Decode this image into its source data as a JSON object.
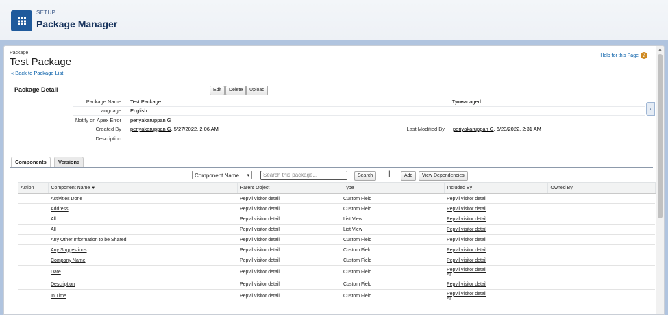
{
  "header": {
    "section": "SETUP",
    "title": "Package Manager",
    "app_icon": "app-launcher-grid-icon"
  },
  "page": {
    "breadcrumb": "Package",
    "title": "Test Package",
    "back_link": "« Back to Package List",
    "help_link": "Help for this Page",
    "help_icon": "help-question-icon"
  },
  "detail": {
    "heading": "Package Detail",
    "buttons": {
      "edit": "Edit",
      "delete": "Delete",
      "upload": "Upload"
    },
    "labels": {
      "package_name": "Package Name",
      "language": "Language",
      "notify": "Notify on Apex Error",
      "created_by": "Created By",
      "description": "Description",
      "type": "Type",
      "last_modified_by": "Last Modified By"
    },
    "values": {
      "package_name": "Test Package",
      "language": "English",
      "notify": "periyakaruppan G",
      "created_by_user": "periyakaruppan G",
      "created_by_date": ", 5/27/2022, 2:06 AM",
      "description": "",
      "type": "Unmanaged",
      "last_modified_user": "periyakaruppan G",
      "last_modified_date": ", 6/23/2022, 2:31 AM"
    }
  },
  "tabs": {
    "components": "Components",
    "versions": "Versions"
  },
  "toolbar": {
    "select_value": "Component Name",
    "search_placeholder": "Search this package...",
    "search_label": "Search",
    "add_label": "Add",
    "view_deps_label": "View Dependencies"
  },
  "table": {
    "columns": {
      "action": "Action",
      "component_name": "Component Name",
      "parent_object": "Parent Object",
      "type": "Type",
      "included_by": "Included By",
      "owned_by": "Owned By"
    },
    "sort_icon": "sort-descending-icon",
    "rows": [
      {
        "name": "Activities Done",
        "parent": "Pepvil visitor detail",
        "type": "Custom Field",
        "included": "Pepvil visitor detail",
        "included_sub": ""
      },
      {
        "name": "Address",
        "parent": "Pepvil visitor detail",
        "type": "Custom Field",
        "included": "Pepvil visitor detail",
        "included_sub": ""
      },
      {
        "name": "All",
        "parent": "Pepvil visitor detail",
        "type": "List View",
        "included": "Pepvil visitor detail",
        "included_sub": ""
      },
      {
        "name": "All",
        "parent": "Pepvil visitor detail",
        "type": "List View",
        "included": "Pepvil visitor detail",
        "included_sub": ""
      },
      {
        "name": "Any Other Information to be Shared",
        "parent": "Pepvil visitor detail",
        "type": "Custom Field",
        "included": "Pepvil visitor detail",
        "included_sub": ""
      },
      {
        "name": "Any Suggestions",
        "parent": "Pepvil visitor detail",
        "type": "Custom Field",
        "included": "Pepvil visitor detail",
        "included_sub": ""
      },
      {
        "name": "Company Name",
        "parent": "Pepvil visitor detail",
        "type": "Custom Field",
        "included": "Pepvil visitor detail",
        "included_sub": ""
      },
      {
        "name": "Date",
        "parent": "Pepvil visitor detail",
        "type": "Custom Field",
        "included": "Pepvil visitor detail",
        "included_sub": "All"
      },
      {
        "name": "Description",
        "parent": "Pepvil visitor detail",
        "type": "Custom Field",
        "included": "Pepvil visitor detail",
        "included_sub": ""
      },
      {
        "name": "In Time",
        "parent": "Pepvil visitor detail",
        "type": "Custom Field",
        "included": "Pepvil visitor detail",
        "included_sub": "All"
      }
    ]
  }
}
